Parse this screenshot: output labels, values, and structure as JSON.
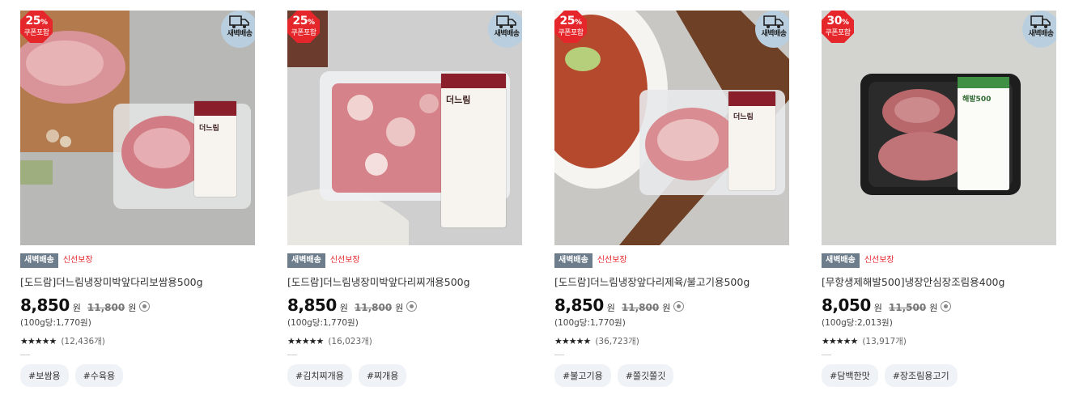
{
  "products": [
    {
      "discount": "25",
      "discount_unit": "%",
      "coupon_label": "쿠폰포함",
      "delivery_badge": "새벽배송",
      "truck_icon": "truck-icon",
      "tag_delivery": "새벽배송",
      "tag_fresh": "신선보장",
      "name": "[도드람]더느림냉장미박앞다리보쌈용500g",
      "price": "8,850",
      "currency": "원",
      "original_price": "11,800",
      "unit_price": "(100g당:1,770원)",
      "rating_stars": 5,
      "review_count": "(12,436개)",
      "hashtags": [
        "#보쌈용",
        "#수육용"
      ],
      "label_brand": "더느림"
    },
    {
      "discount": "25",
      "discount_unit": "%",
      "coupon_label": "쿠폰포함",
      "delivery_badge": "새벽배송",
      "truck_icon": "truck-icon",
      "tag_delivery": "새벽배송",
      "tag_fresh": "신선보장",
      "name": "[도드람]더느림냉장미박앞다리찌개용500g",
      "price": "8,850",
      "currency": "원",
      "original_price": "11,800",
      "unit_price": "(100g당:1,770원)",
      "rating_stars": 5,
      "review_count": "(16,023개)",
      "hashtags": [
        "#김치찌개용",
        "#찌개용"
      ],
      "label_brand": "더느림"
    },
    {
      "discount": "25",
      "discount_unit": "%",
      "coupon_label": "쿠폰포함",
      "delivery_badge": "새벽배송",
      "truck_icon": "truck-icon",
      "tag_delivery": "새벽배송",
      "tag_fresh": "신선보장",
      "name": "[도드람]더느림냉장앞다리제육/불고기용500g",
      "price": "8,850",
      "currency": "원",
      "original_price": "11,800",
      "unit_price": "(100g당:1,770원)",
      "rating_stars": 5,
      "review_count": "(36,723개)",
      "hashtags": [
        "#불고기용",
        "#쫄깃쫄깃"
      ],
      "label_brand": "더느림"
    },
    {
      "discount": "30",
      "discount_unit": "%",
      "coupon_label": "쿠폰포함",
      "delivery_badge": "새벽배송",
      "truck_icon": "truck-icon",
      "tag_delivery": "새벽배송",
      "tag_fresh": "신선보장",
      "name": "[무항생제해발500]냉장안심장조림용400g",
      "price": "8,050",
      "currency": "원",
      "original_price": "11,500",
      "unit_price": "(100g당:2,013원)",
      "rating_stars": 5,
      "review_count": "(13,917개)",
      "hashtags": [
        "#담백한맛",
        "#장조림용고기"
      ],
      "label_brand": "해발500"
    }
  ],
  "colors": {
    "discount_badge": "#e5262a",
    "delivery_badge": "#b9cfe0",
    "tag_dark": "#6e7d8c",
    "fresh_text": "#e5262a",
    "hashtag_bg": "#eff2f6"
  }
}
